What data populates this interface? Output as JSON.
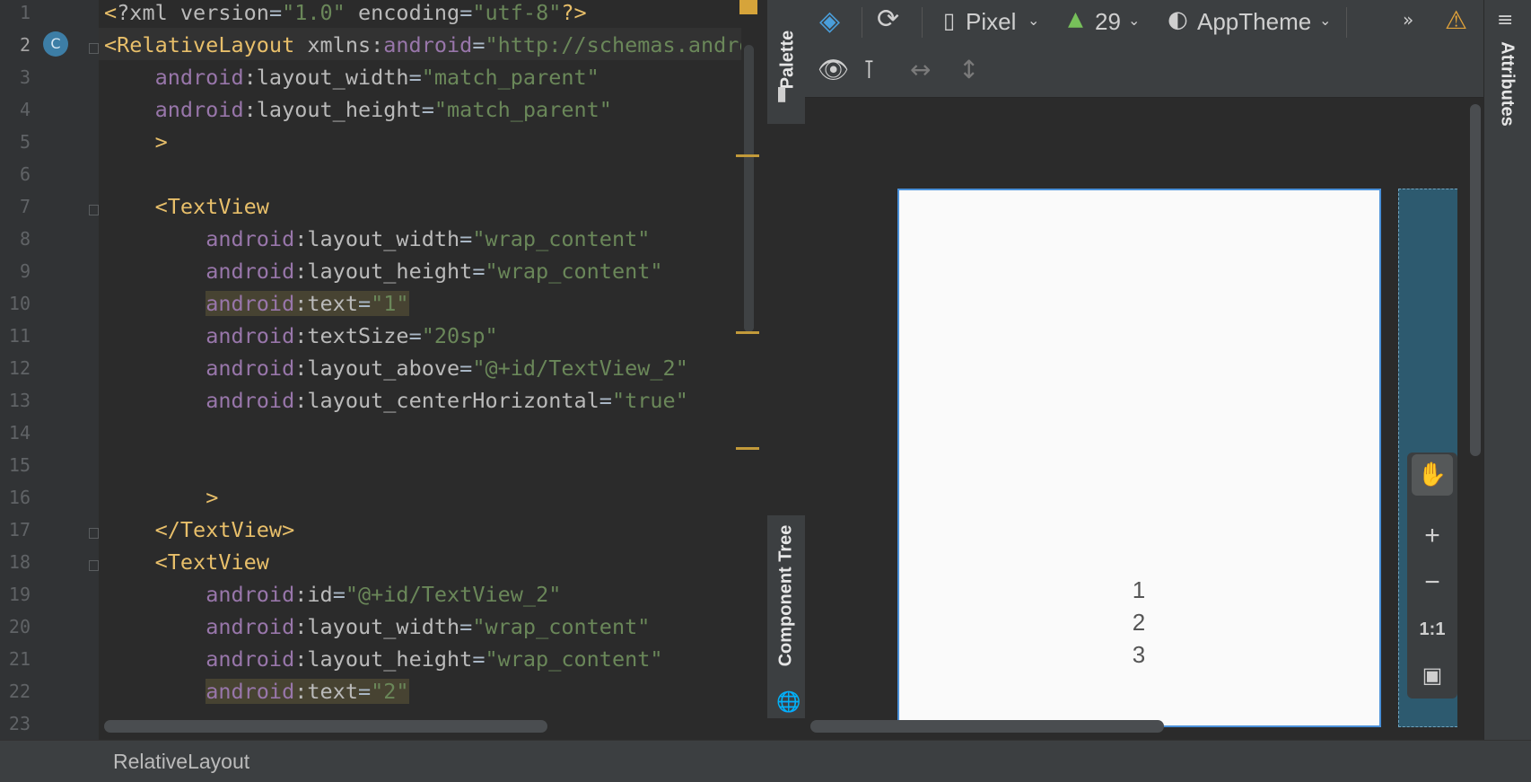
{
  "editor": {
    "lines": [
      {
        "n": "1",
        "segs": [
          [
            "t-tag",
            "<"
          ],
          [
            "t-attr",
            "?xml version"
          ],
          [
            "t-eq",
            "="
          ],
          [
            "t-str",
            "\"1.0\""
          ],
          [
            "t-attr",
            " encoding"
          ],
          [
            "t-eq",
            "="
          ],
          [
            "t-str",
            "\"utf-8\""
          ],
          [
            "t-tag",
            "?>"
          ]
        ]
      },
      {
        "n": "2",
        "segs": [
          [
            "t-tag",
            "<RelativeLayout "
          ],
          [
            "t-attr",
            "xmlns:"
          ],
          [
            "t-ns",
            "android"
          ],
          [
            "t-eq",
            "="
          ],
          [
            "t-str",
            "\"http://schemas.android.com/apk/res/android\""
          ]
        ]
      },
      {
        "n": "3",
        "segs": [
          [
            "",
            "    "
          ],
          [
            "t-ns",
            "android"
          ],
          [
            "t-attr",
            ":layout_width"
          ],
          [
            "t-eq",
            "="
          ],
          [
            "t-str",
            "\"match_parent\""
          ]
        ]
      },
      {
        "n": "4",
        "segs": [
          [
            "",
            "    "
          ],
          [
            "t-ns",
            "android"
          ],
          [
            "t-attr",
            ":layout_height"
          ],
          [
            "t-eq",
            "="
          ],
          [
            "t-str",
            "\"match_parent\""
          ]
        ]
      },
      {
        "n": "5",
        "segs": [
          [
            "",
            "    "
          ],
          [
            "t-tag",
            ">"
          ]
        ]
      },
      {
        "n": "6",
        "segs": []
      },
      {
        "n": "7",
        "segs": [
          [
            "",
            "    "
          ],
          [
            "t-tag",
            "<TextView"
          ]
        ]
      },
      {
        "n": "8",
        "segs": [
          [
            "",
            "        "
          ],
          [
            "t-ns",
            "android"
          ],
          [
            "t-attr",
            ":layout_width"
          ],
          [
            "t-eq",
            "="
          ],
          [
            "t-str",
            "\"wrap_content\""
          ]
        ]
      },
      {
        "n": "9",
        "segs": [
          [
            "",
            "        "
          ],
          [
            "t-ns",
            "android"
          ],
          [
            "t-attr",
            ":layout_height"
          ],
          [
            "t-eq",
            "="
          ],
          [
            "t-str",
            "\"wrap_content\""
          ]
        ]
      },
      {
        "n": "10",
        "hl": true,
        "segs": [
          [
            "",
            "        "
          ],
          [
            "t-ns",
            "android"
          ],
          [
            "t-attr",
            ":text"
          ],
          [
            "t-eq",
            "="
          ],
          [
            "t-str",
            "\"1\""
          ]
        ]
      },
      {
        "n": "11",
        "segs": [
          [
            "",
            "        "
          ],
          [
            "t-ns",
            "android"
          ],
          [
            "t-attr",
            ":textSize"
          ],
          [
            "t-eq",
            "="
          ],
          [
            "t-str",
            "\"20sp\""
          ]
        ]
      },
      {
        "n": "12",
        "segs": [
          [
            "",
            "        "
          ],
          [
            "t-ns",
            "android"
          ],
          [
            "t-attr",
            ":layout_above"
          ],
          [
            "t-eq",
            "="
          ],
          [
            "t-str",
            "\"@+id/TextView_2\""
          ]
        ]
      },
      {
        "n": "13",
        "segs": [
          [
            "",
            "        "
          ],
          [
            "t-ns",
            "android"
          ],
          [
            "t-attr",
            ":layout_centerHorizontal"
          ],
          [
            "t-eq",
            "="
          ],
          [
            "t-str",
            "\"true\""
          ]
        ]
      },
      {
        "n": "14",
        "segs": []
      },
      {
        "n": "15",
        "segs": []
      },
      {
        "n": "16",
        "segs": [
          [
            "",
            "        "
          ],
          [
            "t-tag",
            ">"
          ]
        ]
      },
      {
        "n": "17",
        "segs": [
          [
            "",
            "    "
          ],
          [
            "t-tag",
            "</TextView>"
          ]
        ]
      },
      {
        "n": "18",
        "segs": [
          [
            "",
            "    "
          ],
          [
            "t-tag",
            "<TextView"
          ]
        ]
      },
      {
        "n": "19",
        "segs": [
          [
            "",
            "        "
          ],
          [
            "t-ns",
            "android"
          ],
          [
            "t-attr",
            ":id"
          ],
          [
            "t-eq",
            "="
          ],
          [
            "t-str",
            "\"@+id/TextView_2\""
          ]
        ]
      },
      {
        "n": "20",
        "segs": [
          [
            "",
            "        "
          ],
          [
            "t-ns",
            "android"
          ],
          [
            "t-attr",
            ":layout_width"
          ],
          [
            "t-eq",
            "="
          ],
          [
            "t-str",
            "\"wrap_content\""
          ]
        ]
      },
      {
        "n": "21",
        "segs": [
          [
            "",
            "        "
          ],
          [
            "t-ns",
            "android"
          ],
          [
            "t-attr",
            ":layout_height"
          ],
          [
            "t-eq",
            "="
          ],
          [
            "t-str",
            "\"wrap_content\""
          ]
        ]
      },
      {
        "n": "22",
        "hl": true,
        "segs": [
          [
            "",
            "        "
          ],
          [
            "t-ns",
            "android"
          ],
          [
            "t-attr",
            ":text"
          ],
          [
            "t-eq",
            "="
          ],
          [
            "t-str",
            "\"2\""
          ]
        ]
      },
      {
        "n": "23",
        "segs": []
      }
    ]
  },
  "side_tabs": {
    "palette": "Palette",
    "component_tree": "Component Tree",
    "attributes": "Attributes"
  },
  "toolbar": {
    "device": "Pixel",
    "api": "29",
    "theme": "AppTheme"
  },
  "preview": {
    "texts": [
      "1",
      "2",
      "3"
    ]
  },
  "zoom": {
    "one_to_one": "1:1"
  },
  "status": {
    "breadcrumb": "RelativeLayout"
  },
  "colors": {
    "accent": "#4a90d9",
    "bg": "#2b2b2b",
    "panel": "#3c3f41"
  }
}
